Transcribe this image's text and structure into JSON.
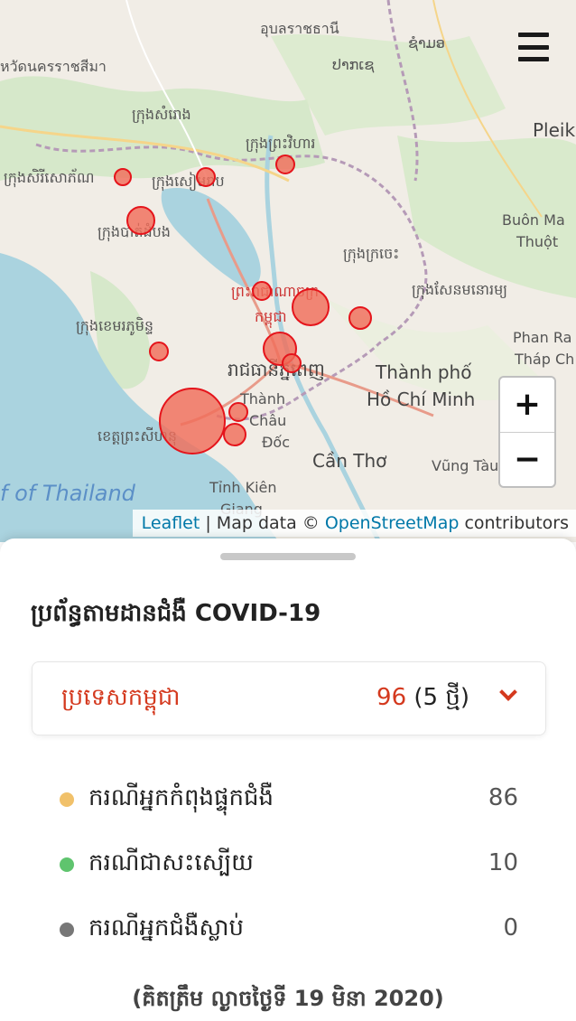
{
  "map": {
    "labels": [
      {
        "text": "อุบลราชธานี",
        "cls": ""
      },
      {
        "text": "ຊຳມອ",
        "cls": ""
      },
      {
        "text": "ປາກເຊ",
        "cls": ""
      },
      {
        "text": "หวัดนครราชสีมา",
        "cls": ""
      },
      {
        "text": "ក្រុងសំរោង",
        "cls": ""
      },
      {
        "text": "Pleiku",
        "cls": "city"
      },
      {
        "text": "ក្រុងព្រះវិហារ",
        "cls": ""
      },
      {
        "text": "ក្រុងសិរីសោភ័ណ",
        "cls": ""
      },
      {
        "text": "ក្រុងសៀមរាប",
        "cls": ""
      },
      {
        "text": "ក្រុងបាត់ដំបង",
        "cls": ""
      },
      {
        "text": "Buôn Ma",
        "cls": ""
      },
      {
        "text": "Thuột",
        "cls": ""
      },
      {
        "text": "ក្រុងក្រចេះ",
        "cls": ""
      },
      {
        "text": "ក្រុងសែនមនោរម្យ",
        "cls": ""
      },
      {
        "text": "ព្រះរាជាណាចក្រ",
        "cls": "red"
      },
      {
        "text": "កម្ពុជា",
        "cls": "red"
      },
      {
        "text": "ក្រុងខេមរភូមិន្ទ",
        "cls": ""
      },
      {
        "text": "Phan Ra",
        "cls": ""
      },
      {
        "text": "Tháp Ch",
        "cls": ""
      },
      {
        "text": "រាជធានីភ្នំពេញ",
        "cls": "city"
      },
      {
        "text": "Thành phố",
        "cls": "city"
      },
      {
        "text": "Hồ Chí Minh",
        "cls": "city"
      },
      {
        "text": "Thành",
        "cls": ""
      },
      {
        "text": "Châu",
        "cls": ""
      },
      {
        "text": "Đốc",
        "cls": ""
      },
      {
        "text": "ខេត្តព្រះសីហនុ",
        "cls": ""
      },
      {
        "text": "Cần Thơ",
        "cls": "city"
      },
      {
        "text": "Vũng Tàu",
        "cls": ""
      },
      {
        "text": "f of Thailand",
        "cls": "sea"
      },
      {
        "text": "Tỉnh Kiên",
        "cls": ""
      },
      {
        "text": "Giang",
        "cls": ""
      }
    ],
    "bubbles": [
      {
        "name": "Battambang area (Sisophon)",
        "cases": 1
      },
      {
        "name": "Siem Reap",
        "cases": 1
      },
      {
        "name": "Preah Vihear",
        "cases": 1
      },
      {
        "name": "Battambang",
        "cases": 3
      },
      {
        "name": "Kampong Cham area",
        "cases": 1
      },
      {
        "name": "Kampong Cham",
        "cases": 6
      },
      {
        "name": "Tbong Khmum",
        "cases": 2
      },
      {
        "name": "Koh Kong",
        "cases": 1
      },
      {
        "name": "Kandal",
        "cases": 5
      },
      {
        "name": "Phnom Penh",
        "cases": 1
      },
      {
        "name": "Sihanoukville",
        "cases": 36
      },
      {
        "name": "Kampot",
        "cases": 1
      },
      {
        "name": "Kep",
        "cases": 2
      }
    ],
    "zoom_in": "+",
    "zoom_out": "−",
    "attribution": {
      "leaflet": "Leaflet",
      "sep": " | Map data © ",
      "osm": "OpenStreetMap",
      "tail": " contributors"
    }
  },
  "sheet": {
    "title": "ប្រព័ន្ធតាមដានជំងឺ COVID-19",
    "country": {
      "name": "ប្រទេសកម្ពុជា",
      "total": "96",
      "new": "(5 ថ្មី)"
    },
    "stats": [
      {
        "label": "ករណីអ្នកកំពុងផ្ទុកជំងឺ",
        "value": "86",
        "color": "#f1c16a"
      },
      {
        "label": "ករណីជាសះស្បើយ",
        "value": "10",
        "color": "#5fc46e"
      },
      {
        "label": "ករណីអ្នកជំងឺស្លាប់",
        "value": "0",
        "color": "#777777"
      }
    ],
    "as_of": "(គិតត្រឹម ល្ងាចថ្ងៃទី 19 មិនា 2020)"
  },
  "colors": {
    "accent": "#d4391e",
    "bubble_fill": "#f06e5a",
    "bubble_stroke": "#e5141b",
    "link": "#0078a8"
  }
}
